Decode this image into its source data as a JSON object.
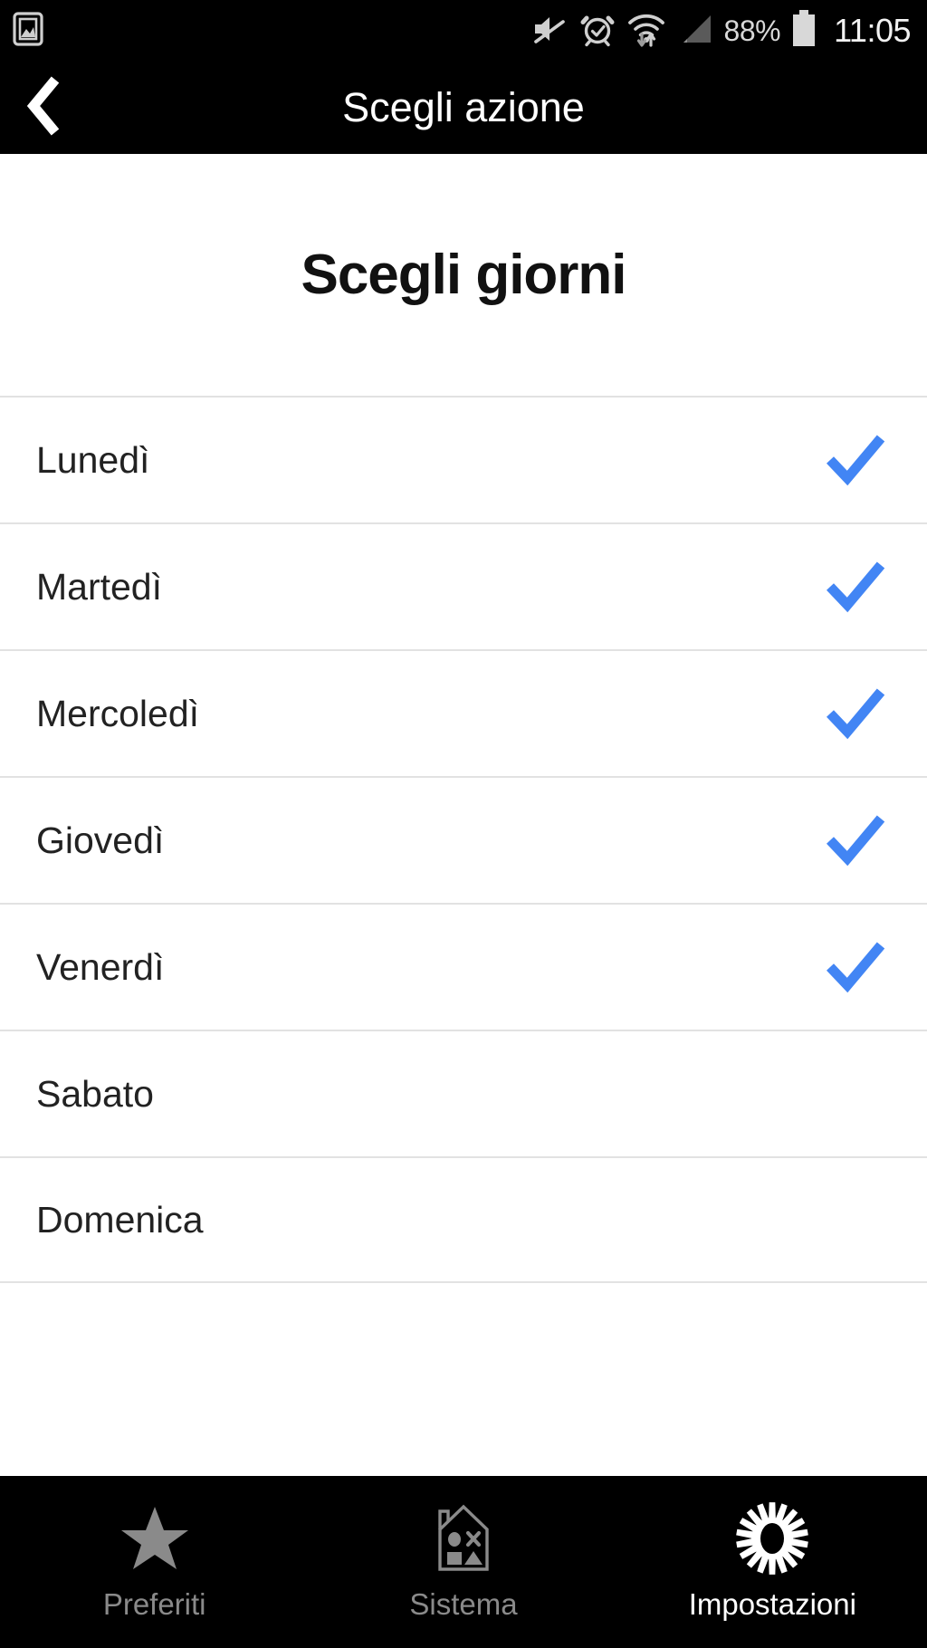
{
  "statusbar": {
    "left_icons": [
      {
        "name": "screenshot-image-icon",
        "label": "screenshot"
      }
    ],
    "right_icons": [
      {
        "name": "volume-mute-icon",
        "label": "mute"
      },
      {
        "name": "alarm-clock-icon",
        "label": "alarm"
      },
      {
        "name": "wifi-data-transfer-icon",
        "label": "wifi"
      },
      {
        "name": "cell-signal-icon",
        "label": "signal"
      }
    ],
    "battery_percent": "88%",
    "clock": "11:05"
  },
  "appbar": {
    "back_label": "Indietro",
    "title": "Scegli azione"
  },
  "main": {
    "heading": "Scegli giorni",
    "days": [
      {
        "label": "Lunedì",
        "checked": true
      },
      {
        "label": "Martedì",
        "checked": true
      },
      {
        "label": "Mercoledì",
        "checked": true
      },
      {
        "label": "Giovedì",
        "checked": true
      },
      {
        "label": "Venerdì",
        "checked": true
      },
      {
        "label": "Sabato",
        "checked": false
      },
      {
        "label": "Domenica",
        "checked": false
      }
    ]
  },
  "bottomnav": {
    "items": [
      {
        "label": "Preferiti",
        "icon": "star-icon",
        "active": false
      },
      {
        "label": "Sistema",
        "icon": "house-shapes-icon",
        "active": false
      },
      {
        "label": "Impostazioni",
        "icon": "gear-icon",
        "active": true
      }
    ]
  },
  "colors": {
    "accent_check": "#4285f4",
    "bar_background": "#000000",
    "page_background": "#ffffff",
    "divider": "#e2e2e2",
    "nav_inactive": "#8a8a8a",
    "nav_active": "#ffffff"
  }
}
